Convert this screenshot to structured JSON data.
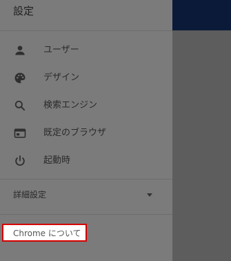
{
  "drawer": {
    "title": "設定",
    "items": [
      {
        "label": "ユーザー",
        "icon": "person-icon"
      },
      {
        "label": "デザイン",
        "icon": "palette-icon"
      },
      {
        "label": "検索エンジン",
        "icon": "search-icon"
      },
      {
        "label": "既定のブラウザ",
        "icon": "browser-window-icon"
      },
      {
        "label": "起動時",
        "icon": "power-icon"
      }
    ],
    "advanced_label": "詳細設定",
    "about_label": "Chrome について"
  },
  "colors": {
    "drawer_bg": "#7b7b7b",
    "overlay_bg": "#5d5d5d",
    "topbar_bg": "#0b1a38",
    "highlight_border": "#d60000"
  }
}
